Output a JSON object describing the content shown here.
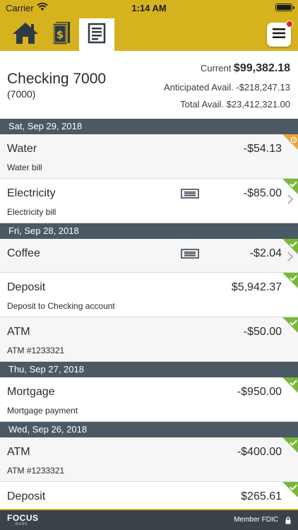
{
  "status_bar": {
    "carrier": "Carrier",
    "time": "1:14 AM"
  },
  "toolbar": {
    "tabs": [
      {
        "icon": "home-icon"
      },
      {
        "icon": "money-icon"
      },
      {
        "icon": "register-icon",
        "selected": true
      }
    ],
    "menu_icon": "hamburger-menu-icon",
    "notification": true
  },
  "account": {
    "name": "Checking 7000",
    "number": "(7000)",
    "current_label": "Current ",
    "current_value": "$99,382.18",
    "anticipated": "Anticipated Avail. -$218,247.13",
    "total": "Total Avail. $23,412,321.00"
  },
  "groups": [
    {
      "date": "Sat, Sep 29, 2018",
      "items": [
        {
          "title": "Water",
          "desc": "Water bill",
          "amount": "-$54.13",
          "status": "pending"
        },
        {
          "title": "Electricity",
          "desc": "Electricity bill",
          "amount": "-$85.00",
          "status": "cleared",
          "memo": true
        }
      ]
    },
    {
      "date": "Fri, Sep 28, 2018",
      "items": [
        {
          "title": "Coffee",
          "desc": "",
          "amount": "-$2.04",
          "status": "cleared",
          "memo": true
        },
        {
          "title": "Deposit",
          "desc": "Deposit to Checking account",
          "amount": "$5,942.37",
          "status": "cleared"
        },
        {
          "title": "ATM",
          "desc": "ATM #1233321",
          "amount": "-$50.00",
          "status": "cleared"
        }
      ]
    },
    {
      "date": "Thu, Sep 27, 2018",
      "items": [
        {
          "title": "Mortgage",
          "desc": "Mortgage payment",
          "amount": "-$950.00",
          "status": "cleared"
        }
      ]
    },
    {
      "date": "Wed, Sep 26, 2018",
      "items": [
        {
          "title": "ATM",
          "desc": "ATM #1233321",
          "amount": "-$400.00",
          "status": "cleared"
        },
        {
          "title": "Deposit",
          "desc": "",
          "amount": "$265.61",
          "status": "cleared"
        }
      ]
    }
  ],
  "footer": {
    "logo": "FOCUS",
    "logo_sub": "BANK",
    "fdic": "Member FDIC"
  },
  "colors": {
    "brand": "#d6b21e",
    "header_bg": "#4a5963",
    "cleared": "#78b83a",
    "pending": "#e8a63a",
    "footer_bg": "#3b4349"
  }
}
